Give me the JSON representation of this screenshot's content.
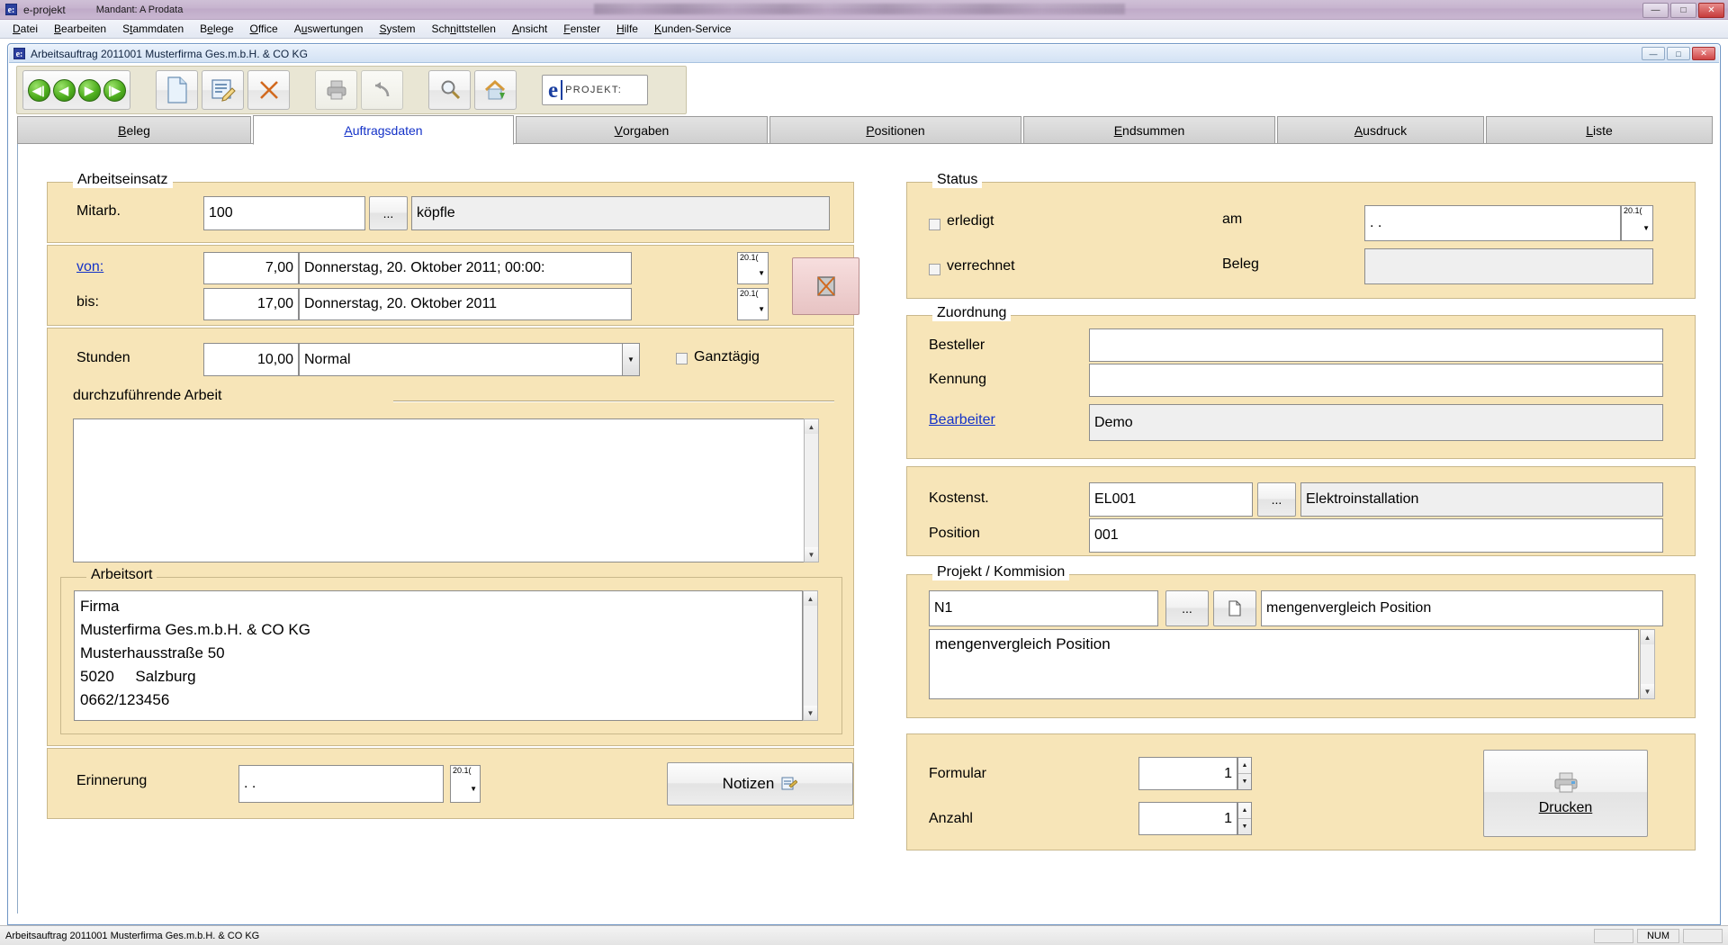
{
  "app": {
    "title": "e-projekt",
    "mandant": "Mandant: A  Prodata",
    "icon": "e:",
    "min_label": "—",
    "max_label": "□",
    "close_label": "✕"
  },
  "menubar": {
    "items": [
      {
        "label": "Datei"
      },
      {
        "label": "Bearbeiten"
      },
      {
        "label": "Stammdaten"
      },
      {
        "label": "Belege"
      },
      {
        "label": "Office"
      },
      {
        "label": "Auswertungen"
      },
      {
        "label": "System"
      },
      {
        "label": "Schnittstellen"
      },
      {
        "label": "Ansicht"
      },
      {
        "label": "Fenster"
      },
      {
        "label": "Hilfe"
      },
      {
        "label": "Kunden-Service"
      }
    ]
  },
  "mdi": {
    "icon": "e:",
    "title": "Arbeitsauftrag  2011001  Musterfirma Ges.m.b.H. & CO KG",
    "min_label": "—",
    "max_label": "□",
    "close_label": "✕"
  },
  "toolbar": {
    "nav_first": "⏮",
    "nav_prev": "◀",
    "nav_next": "▶",
    "nav_last": "⏭",
    "new_label": "new-document",
    "edit_label": "edit-document",
    "delete_label": "✕",
    "print_label": "print",
    "undo_label": "↶",
    "search_label": "search",
    "home_label": "home",
    "brand_e": "e",
    "brand_text": "PROJEKT:"
  },
  "tabs": [
    {
      "label": "Beleg",
      "active": false
    },
    {
      "label": "Auftragsdaten",
      "active": true
    },
    {
      "label": "Vorgaben",
      "active": false
    },
    {
      "label": "Positionen",
      "active": false
    },
    {
      "label": "Endsummen",
      "active": false
    },
    {
      "label": "Ausdruck",
      "active": false
    },
    {
      "label": "Liste",
      "active": false
    }
  ],
  "arbeitseinsatz": {
    "legend": "Arbeitseinsatz",
    "mitarb_label": "Mitarb.",
    "mitarb_value": "100",
    "mitarb_browse": "...",
    "mitarb_name": "köpfle",
    "von_label": "von:",
    "von_hours": "7,00",
    "von_date": "Donnerstag, 20. Oktober 2011; 00:00:",
    "von_picker": "20.1(",
    "bis_label": "bis:",
    "bis_hours": "17,00",
    "bis_date": "Donnerstag, 20. Oktober 2011",
    "bis_picker": "20.1(",
    "calc_button": "calculator-icon",
    "stunden_label": "Stunden",
    "stunden_value": "10,00",
    "stunden_type": "Normal",
    "ganztaegig_label": "Ganztägig",
    "ganztaegig_checked": false,
    "arbeit_label": "durchzuführende Arbeit",
    "arbeit_value": ""
  },
  "arbeitsort": {
    "legend": "Arbeitsort",
    "lines": [
      "Firma",
      "Musterfirma Ges.m.b.H. & CO KG",
      "Musterhausstraße 50",
      "5020     Salzburg",
      "0662/123456"
    ]
  },
  "erinnerung": {
    "label": "Erinnerung",
    "value": ".  .",
    "picker": "20.1(",
    "notizen_label": "Notizen"
  },
  "status": {
    "legend": "Status",
    "erledigt_label": "erledigt",
    "erledigt_checked": false,
    "verrechnet_label": "verrechnet",
    "verrechnet_checked": false,
    "am_label": "am",
    "am_value": ".  .",
    "am_picker": "20.1(",
    "beleg_label": "Beleg",
    "beleg_value": ""
  },
  "zuordnung": {
    "legend": "Zuordnung",
    "besteller_label": "Besteller",
    "besteller_value": "",
    "kennung_label": "Kennung",
    "kennung_value": "",
    "bearbeiter_label": "Bearbeiter",
    "bearbeiter_value": "Demo",
    "kostenst_label": "Kostenst.",
    "kostenst_value": "EL001",
    "kostenst_browse": "...",
    "kostenst_name": "Elektroinstallation",
    "position_label": "Position",
    "position_value": "001"
  },
  "projekt": {
    "legend": "Projekt / Kommision",
    "code_value": "N1",
    "browse_label": "...",
    "doc_label": "document-icon",
    "name_value": "mengenvergleich Position",
    "description_value": "mengenvergleich Position"
  },
  "druck": {
    "formular_label": "Formular",
    "formular_value": "1",
    "anzahl_label": "Anzahl",
    "anzahl_value": "1",
    "drucken_label": "Drucken"
  },
  "statusbar": {
    "text": "Arbeitsauftrag  2011001  Musterfirma Ges.m.b.H. & CO KG",
    "cells": [
      "",
      "NUM",
      ""
    ]
  },
  "colors": {
    "panel": "#f7e5b8",
    "panel_border": "#c9b88c",
    "accent_link": "#1432c8",
    "tab_active_text": "#1432c8",
    "titlebar": "#c6b3ce"
  }
}
